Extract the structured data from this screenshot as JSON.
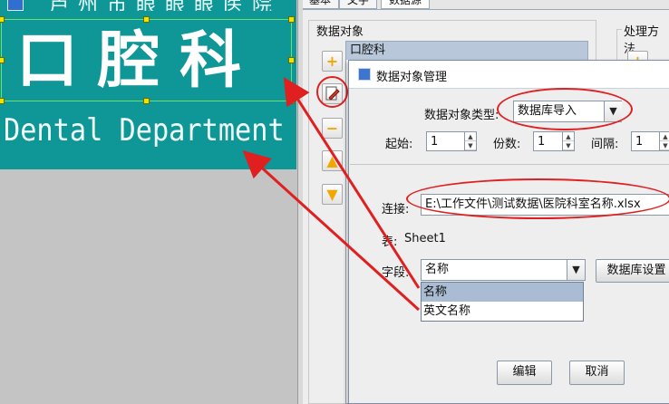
{
  "canvas": {
    "top_strip_text": "芦州市眼眼眼医院",
    "label_title_cn": "口腔科",
    "label_title_en": "Dental Department"
  },
  "panel": {
    "tabs": [
      "基本",
      "文字",
      "数据源"
    ],
    "data_object_group_label": "数据对象",
    "process_group_label": "处理方法",
    "data_object_list": [
      "口腔科"
    ]
  },
  "dialog": {
    "title": "数据对象管理",
    "type_label": "数据对象类型:",
    "type_value": "数据库导入",
    "start_label": "起始:",
    "start_value": "1",
    "copies_label": "份数:",
    "copies_value": "1",
    "interval_label": "间隔:",
    "interval_value": "1",
    "connection_label": "连接:",
    "connection_value": "E:\\工作文件\\测试数据\\医院科室名称.xlsx",
    "table_label": "表:",
    "table_value": "Sheet1",
    "field_label": "字段:",
    "field_value": "名称",
    "db_settings_button": "数据库设置",
    "field_options": [
      "名称",
      "英文名称"
    ],
    "edit_button": "编辑",
    "cancel_button": "取消"
  },
  "colors": {
    "label_background": "#0f9696",
    "annotation_red": "#e02020",
    "dialog_accent": "#3f74cf"
  },
  "icons": {
    "toolbar": [
      "add-icon",
      "edit-icon",
      "remove-icon",
      "move-up-icon",
      "move-down-icon"
    ]
  }
}
